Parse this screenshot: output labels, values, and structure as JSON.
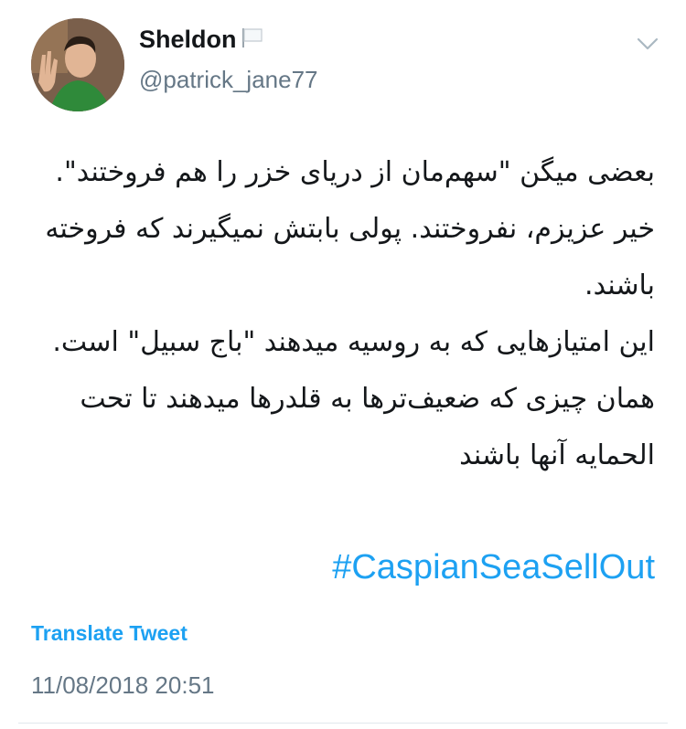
{
  "tweet": {
    "display_name": "Sheldon",
    "handle": "@patrick_jane77",
    "text": "بعضی میگن \"سهم‌مان از دریای خزر را هم فروختند\".\nخیر عزیزم، نفروختند. پولی بابتش نمیگیرند که فروخته باشند.\nاین امتیازهایی که به روسیه میدهند \"باج سبیل\" است. همان چیزی که ضعیف‌ترها به قلدرها میدهند تا تحت الحمایه آنها باشند",
    "hashtag": "#CaspianSeaSellOut",
    "translate_label": "Translate Tweet",
    "timestamp": "11/08/2018 20:51"
  },
  "icons": {
    "flag": "white-flag-icon",
    "menu": "chevron-down-icon"
  },
  "colors": {
    "link": "#1da1f2",
    "secondary": "#657786",
    "text": "#14171a"
  }
}
